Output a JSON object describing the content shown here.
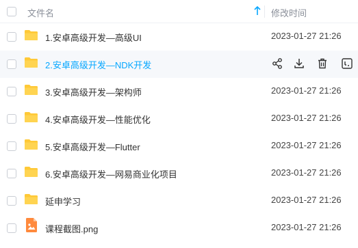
{
  "header": {
    "col_name": "文件名",
    "col_time": "修改时间",
    "sort_icon": "arrow-up-icon"
  },
  "accent": "#06a7ff",
  "folder_color": "#ffc937",
  "files": [
    {
      "name": "1.安卓高级开发—高级UI",
      "time": "2023-01-27 21:26",
      "type": "folder"
    },
    {
      "name": "2.安卓高级开发—NDK开发",
      "time": "",
      "type": "folder",
      "hovered": true
    },
    {
      "name": "3.安卓高级开发—架构师",
      "time": "2023-01-27 21:26",
      "type": "folder"
    },
    {
      "name": "4.安卓高级开发—性能优化",
      "time": "2023-01-27 21:26",
      "type": "folder"
    },
    {
      "name": "5.安卓高级开发—Flutter",
      "time": "2023-01-27 21:26",
      "type": "folder"
    },
    {
      "name": "6.安卓高级开发—网易商业化项目",
      "time": "2023-01-27 21:26",
      "type": "folder"
    },
    {
      "name": "延申学习",
      "time": "2023-01-27 21:26",
      "type": "folder"
    },
    {
      "name": "课程截图.png",
      "time": "2023-01-27 21:26",
      "type": "image"
    }
  ],
  "row_actions": [
    "share-icon",
    "download-icon",
    "delete-icon",
    "more-icon"
  ]
}
